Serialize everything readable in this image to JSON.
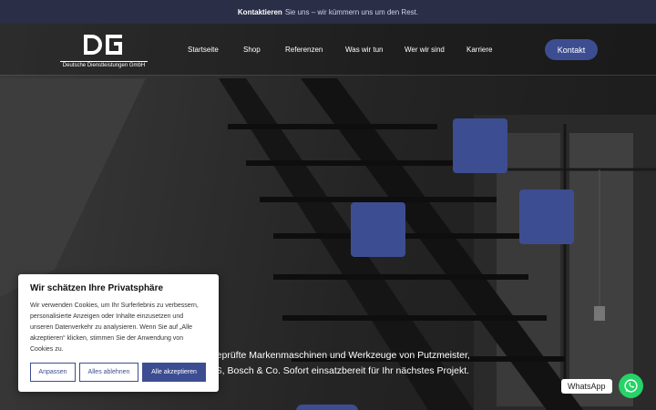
{
  "topbar": {
    "bold": "Kontaktieren",
    "rest": "Sie uns – wir kümmern uns um den Rest."
  },
  "logo": {
    "mark": "DG",
    "subtitle": "Deutsche Dienstleistungen GmbH"
  },
  "nav": [
    "Startseite",
    "Shop",
    "Referenzen",
    "Was wir tun",
    "Wer wir sind",
    "Karriere"
  ],
  "cta": {
    "label": "Kontakt"
  },
  "hero": {
    "line1": "attgeprüfte Markenmaschinen und Werkzeuge von Putzmeister,",
    "line2": "BMS, Bosch & Co. Sofort einsatzbereit für Ihr nächstes Projekt."
  },
  "cookie": {
    "title": "Wir schätzen Ihre Privatsphäre",
    "text": "Wir verwenden Cookies, um Ihr Surferlebnis zu verbessern, personalisierte Anzeigen oder Inhalte einzusetzen und unseren Datenverkehr zu analysieren. Wenn Sie auf „Alle akzeptieren“ klicken, stimmen Sie der Anwendung von Cookies zu.",
    "btn_customize": "Anpassen",
    "btn_reject": "Alles ablehnen",
    "btn_accept": "Alle akzeptieren"
  },
  "whatsapp": {
    "label": "WhatsApp"
  },
  "colors": {
    "accent": "#3d4d91",
    "topbar": "#2a2e47",
    "whatsapp": "#25d366"
  }
}
